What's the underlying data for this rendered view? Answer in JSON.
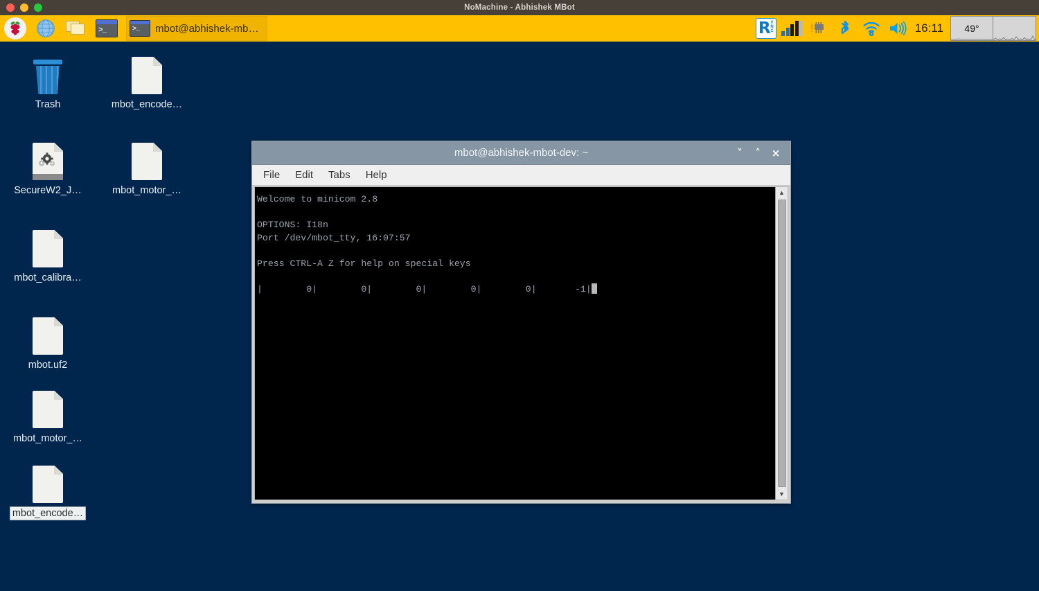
{
  "nomachine": {
    "title": "NoMachine - Abhishek MBot",
    "buttons": [
      "close",
      "minimize",
      "zoom"
    ]
  },
  "taskbar": {
    "launchers": [
      {
        "name": "raspberry-menu",
        "icon": "raspberry-icon",
        "label": ""
      },
      {
        "name": "web-browser",
        "icon": "globe-icon",
        "label": ""
      },
      {
        "name": "file-manager",
        "icon": "folder-icon",
        "label": ""
      },
      {
        "name": "terminal-launcher",
        "icon": "terminal-icon",
        "label": ""
      }
    ],
    "window_button": {
      "label": "mbot@abhishek-mb…",
      "icon": "terminal-icon"
    },
    "tray": [
      {
        "name": "realvnc",
        "icon": "vnc-icon",
        "label": "R",
        "sub": "VNC"
      },
      {
        "name": "cpu-monitor",
        "icon": "cpu-bars-icon"
      },
      {
        "name": "system-chip",
        "icon": "chip-icon"
      },
      {
        "name": "bluetooth",
        "icon": "bluetooth-icon"
      },
      {
        "name": "wifi",
        "icon": "wifi-icon"
      },
      {
        "name": "volume",
        "icon": "volume-icon"
      }
    ],
    "clock": "16:11",
    "widgets": [
      {
        "name": "temperature-widget",
        "value": "49°"
      },
      {
        "name": "graph-widget",
        "value": ""
      }
    ],
    "colors": {
      "bar": "#ffc000",
      "text": "#2b2208"
    }
  },
  "desktop": {
    "background": "#01264e",
    "icons": [
      {
        "name": "trash",
        "label": "Trash",
        "type": "trash",
        "selected": false
      },
      {
        "name": "mbot-encoder-file-1",
        "label": "mbot_encode…",
        "type": "file",
        "selected": false
      },
      {
        "name": "securew2-joinnow",
        "label": "SecureW2_J…",
        "type": "config",
        "selected": false
      },
      {
        "name": "mbot-motor-file-1",
        "label": "mbot_motor_…",
        "type": "file",
        "selected": false
      },
      {
        "name": "mbot-calibration-file",
        "label": "mbot_calibra…",
        "type": "file",
        "selected": false
      },
      {
        "name": "mbot-uf2-file",
        "label": "mbot.uf2",
        "type": "file",
        "selected": false
      },
      {
        "name": "mbot-motor-file-2",
        "label": "mbot_motor_…",
        "type": "file",
        "selected": false
      },
      {
        "name": "mbot-encoder-file-2",
        "label": "mbot_encode…",
        "type": "file",
        "selected": true
      }
    ]
  },
  "terminal": {
    "title": "mbot@abhishek-mbot-dev: ~",
    "menu": [
      "File",
      "Edit",
      "Tabs",
      "Help"
    ],
    "window_buttons": {
      "minimize": "˅",
      "maximize": "˄",
      "close": "×"
    },
    "content": "Welcome to minicom 2.8\n\nOPTIONS: I18n\nPort /dev/mbot_tty, 16:07:57\n\nPress CTRL-A Z for help on special keys\n\n|        0|        0|        0|        0|        0|       -1|",
    "cursor_visible": true,
    "colors": {
      "bg": "#000000",
      "fg": "#9aa6ad",
      "cursor": "#b8b8b8"
    }
  }
}
